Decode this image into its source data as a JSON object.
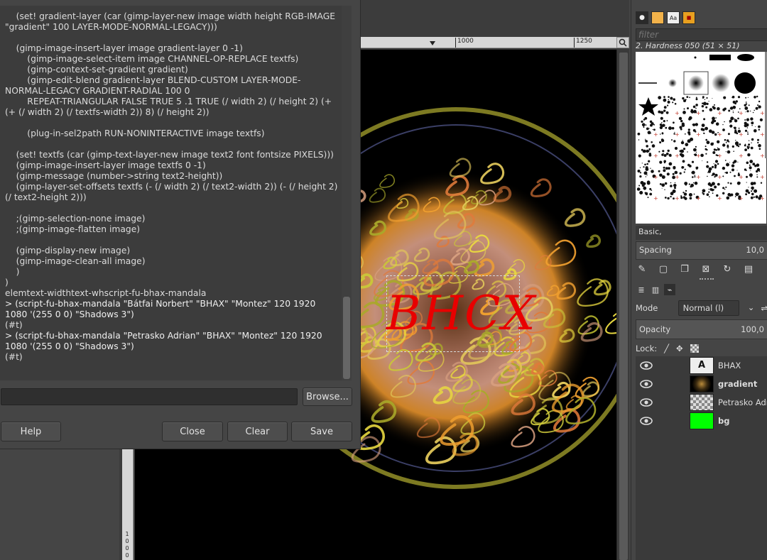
{
  "console": {
    "lines": [
      {
        "text": "    (set! gradient-layer (car (gimp-layer-new image width height RGB-IMAGE \"gradient\" 100 LAYER-MODE-NORMAL-LEGACY)))",
        "kind": "code"
      },
      {
        "text": " ",
        "kind": "blank"
      },
      {
        "text": "    (gimp-image-insert-layer image gradient-layer 0 -1)",
        "kind": "code"
      },
      {
        "text": "        (gimp-image-select-item image CHANNEL-OP-REPLACE textfs)",
        "kind": "code"
      },
      {
        "text": "        (gimp-context-set-gradient gradient)",
        "kind": "code"
      },
      {
        "text": "        (gimp-edit-blend gradient-layer BLEND-CUSTOM LAYER-MODE-NORMAL-LEGACY GRADIENT-RADIAL 100 0",
        "kind": "code"
      },
      {
        "text": "        REPEAT-TRIANGULAR FALSE TRUE 5 .1 TRUE (/ width 2) (/ height 2) (+ (+ (/ width 2) (/ textfs-width 2)) 8) (/ height 2))",
        "kind": "code"
      },
      {
        "text": " ",
        "kind": "blank"
      },
      {
        "text": "        (plug-in-sel2path RUN-NONINTERACTIVE image textfs)",
        "kind": "code"
      },
      {
        "text": " ",
        "kind": "blank"
      },
      {
        "text": "    (set! textfs (car (gimp-text-layer-new image text2 font fontsize PIXELS)))",
        "kind": "code"
      },
      {
        "text": "    (gimp-image-insert-layer image textfs 0 -1)",
        "kind": "code"
      },
      {
        "text": "    (gimp-message (number->string text2-height))",
        "kind": "code"
      },
      {
        "text": "    (gimp-layer-set-offsets textfs (- (/ width 2) (/ text2-width 2)) (- (/ height 2) (/ text2-height 2)))",
        "kind": "code"
      },
      {
        "text": " ",
        "kind": "blank"
      },
      {
        "text": "    ;(gimp-selection-none image)",
        "kind": "code"
      },
      {
        "text": "    ;(gimp-image-flatten image)",
        "kind": "code"
      },
      {
        "text": " ",
        "kind": "blank"
      },
      {
        "text": "    (gimp-display-new image)",
        "kind": "code"
      },
      {
        "text": "    (gimp-image-clean-all image)",
        "kind": "code"
      },
      {
        "text": "    )",
        "kind": "code"
      },
      {
        "text": ")",
        "kind": "code"
      },
      {
        "text": "elemtext-widthtext-whscript-fu-bhax-mandala",
        "kind": "code"
      },
      {
        "text": "> (script-fu-bhax-mandala \"Bátfai Norbert\" \"BHAX\" \"Montez\" 120 1920 1080 '(255 0 0) \"Shadows 3\")",
        "kind": "cmd"
      },
      {
        "text": "(#t)",
        "kind": "code"
      },
      {
        "text": "> (script-fu-bhax-mandala \"Petrasko Adrian\" \"BHAX\" \"Montez\" 120 1920 1080 '(255 0 0) \"Shadows 3\")",
        "kind": "cmd"
      },
      {
        "text": "(#t)",
        "kind": "code"
      }
    ],
    "input_value": "",
    "browse_label": "Browse...",
    "help_label": "Help",
    "close_label": "Close",
    "clear_label": "Clear",
    "save_label": "Save"
  },
  "canvas": {
    "ruler_top_labels": [
      "1000",
      "1250"
    ],
    "ruler_left_label": "1000",
    "image_text": "BHCX"
  },
  "brushes": {
    "filter_placeholder": "filter",
    "selected_brush": "2. Hardness 050 (51 × 51)",
    "tag": "Basic,",
    "spacing_label": "Spacing",
    "spacing_value": "10,0"
  },
  "layers": {
    "mode_label": "Mode",
    "mode_value": "Normal (l)",
    "opacity_label": "Opacity",
    "opacity_value": "100,0",
    "lock_label": "Lock:",
    "items": [
      {
        "name": "BHAX",
        "bold": false,
        "thumb": "text"
      },
      {
        "name": "gradient",
        "bold": true,
        "thumb": "gradient"
      },
      {
        "name": "Petrasko Adri",
        "bold": false,
        "thumb": "pattern"
      },
      {
        "name": "bg",
        "bold": true,
        "thumb": "green"
      }
    ]
  },
  "colors": {
    "text_red": "#e80000",
    "bg_green": "#00ff00",
    "ring": "#7d7a22",
    "inner_ring": "#3b3f66"
  }
}
